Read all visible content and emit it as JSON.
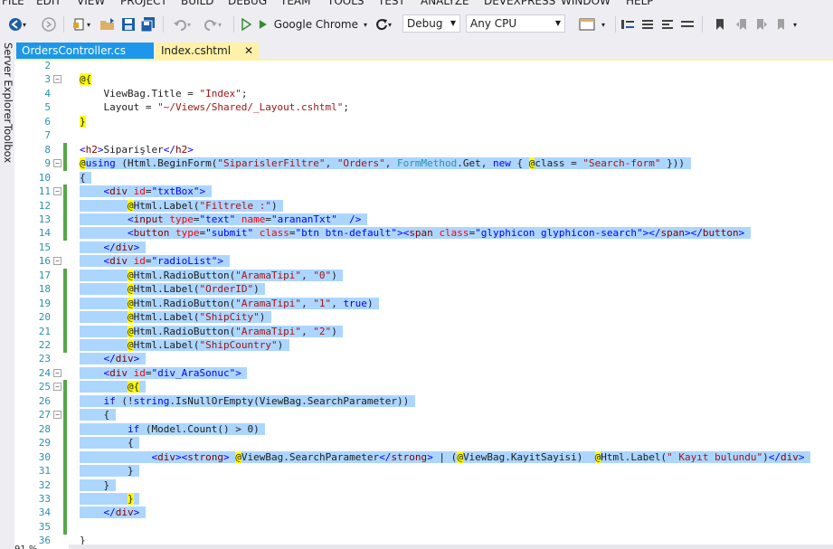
{
  "menu": [
    "FILE",
    "EDIT",
    "VIEW",
    "PROJECT",
    "BUILD",
    "DEBUG",
    "TEAM",
    "TOOLS",
    "TEST",
    "ANALYZE",
    "DEVEXPRESS",
    "WINDOW",
    "HELP"
  ],
  "toolbar": {
    "start_target": "Google Chrome",
    "configuration": "Debug",
    "platform": "Any CPU"
  },
  "side_tabs": [
    "Server Explorer",
    "Toolbox"
  ],
  "tabs": [
    {
      "label": "OrdersController.cs",
      "active": false
    },
    {
      "label": "Index.cshtml",
      "active": true
    }
  ],
  "editor": {
    "zoom": "91 %",
    "lines": [
      {
        "n": "2",
        "text": ""
      },
      {
        "n": "3",
        "text": "@{"
      },
      {
        "n": "4",
        "text": "    ViewBag.Title = \"Index\";"
      },
      {
        "n": "5",
        "text": "    Layout = \"~/Views/Shared/_Layout.cshtml\";"
      },
      {
        "n": "6",
        "text": "}"
      },
      {
        "n": "7",
        "text": ""
      },
      {
        "n": "8",
        "text": "<h2>Siparişler</h2>"
      },
      {
        "n": "9",
        "text": "@using (Html.BeginForm(\"SiparislerFiltre\", \"Orders\", FormMethod.Get, new { @class = \"Search-form\" }))"
      },
      {
        "n": "10",
        "text": "{"
      },
      {
        "n": "11",
        "text": "    <div id=\"txtBox\">"
      },
      {
        "n": "12",
        "text": "        @Html.Label(\"Filtrele :\")"
      },
      {
        "n": "13",
        "text": "        <input type=\"text\" name=\"arananTxt\"  />"
      },
      {
        "n": "14",
        "text": "        <button type=\"submit\" class=\"btn btn-default\"><span class=\"glyphicon glyphicon-search\"></span></button>"
      },
      {
        "n": "15",
        "text": "    </div>"
      },
      {
        "n": "16",
        "text": "    <div id=\"radioList\">"
      },
      {
        "n": "17",
        "text": "        @Html.RadioButton(\"AramaTipi\", \"0\")"
      },
      {
        "n": "18",
        "text": "        @Html.Label(\"OrderID\")"
      },
      {
        "n": "19",
        "text": "        @Html.RadioButton(\"AramaTipi\", \"1\", true)"
      },
      {
        "n": "20",
        "text": "        @Html.Label(\"ShipCity\")"
      },
      {
        "n": "21",
        "text": "        @Html.RadioButton(\"AramaTipi\", \"2\")"
      },
      {
        "n": "22",
        "text": "        @Html.Label(\"ShipCountry\")"
      },
      {
        "n": "23",
        "text": "    </div>"
      },
      {
        "n": "24",
        "text": "    <div id=\"div_AraSonuc\">"
      },
      {
        "n": "25",
        "text": "        @{"
      },
      {
        "n": "26",
        "text": "    if (!string.IsNullOrEmpty(ViewBag.SearchParameter))"
      },
      {
        "n": "27",
        "text": "    {"
      },
      {
        "n": "28",
        "text": "        if (Model.Count() > 0)"
      },
      {
        "n": "29",
        "text": "        {"
      },
      {
        "n": "30",
        "text": "            <div><strong> @ViewBag.SearchParameter</strong> | (@ViewBag.KayitSayisi)  @Html.Label(\" Kayıt bulundu\")</div>"
      },
      {
        "n": "31",
        "text": "        }"
      },
      {
        "n": "32",
        "text": "    }"
      },
      {
        "n": "33",
        "text": "        }"
      },
      {
        "n": "34",
        "text": "    </div>"
      },
      {
        "n": "35",
        "text": ""
      },
      {
        "n": "36",
        "text": "}"
      }
    ]
  }
}
